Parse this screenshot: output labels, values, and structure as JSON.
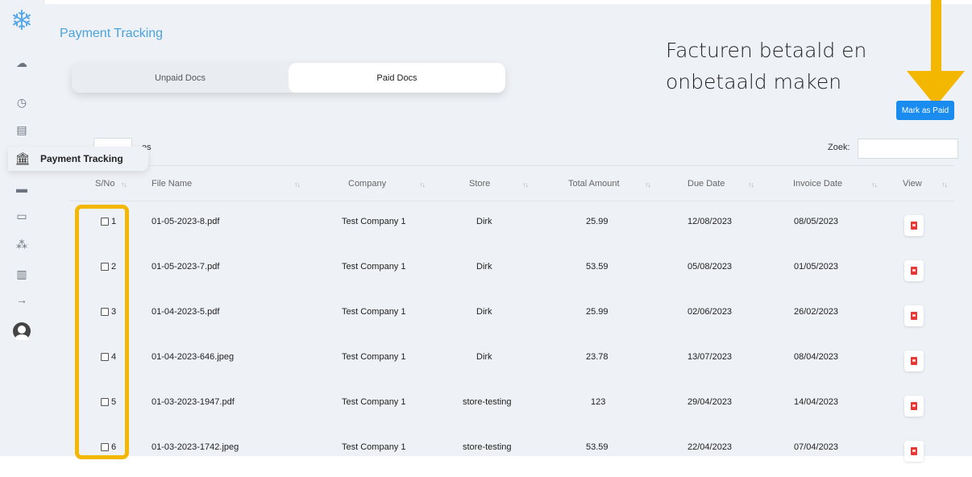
{
  "sidebar": {
    "logo_icon": "snowflake-icon",
    "icons": [
      "cloud-upload-icon",
      "clock-icon",
      "document-icon",
      "bank-icon",
      "book-icon",
      "store-icon",
      "users-icon",
      "building-icon",
      "arrow-right-icon",
      "avatar-icon"
    ],
    "active_item": {
      "label": "Payment Tracking",
      "icon": "bank-icon"
    }
  },
  "header": {
    "title": "Payment Tracking"
  },
  "tabs": [
    {
      "label": "Unpaid Docs",
      "active": false
    },
    {
      "label": "Paid Docs",
      "active": true
    }
  ],
  "annotation": {
    "line1": "Facturen betaald en",
    "line2": "onbetaald maken",
    "color": "#f4b700"
  },
  "toolbar": {
    "mark_paid_label": "Mark as Paid",
    "show_suffix": "es",
    "search_label": "Zoek:",
    "search_value": ""
  },
  "table": {
    "columns": [
      "S/No",
      "File Name",
      "Company",
      "Store",
      "Total Amount",
      "Due Date",
      "Invoice Date",
      "View"
    ],
    "rows": [
      {
        "sno": "1",
        "file": "01-05-2023-8.pdf",
        "company": "Test Company 1",
        "store": "Dirk",
        "amount": "25.99",
        "due": "12/08/2023",
        "invoice": "08/05/2023"
      },
      {
        "sno": "2",
        "file": "01-05-2023-7.pdf",
        "company": "Test Company 1",
        "store": "Dirk",
        "amount": "53.59",
        "due": "05/08/2023",
        "invoice": "01/05/2023"
      },
      {
        "sno": "3",
        "file": "01-04-2023-5.pdf",
        "company": "Test Company 1",
        "store": "Dirk",
        "amount": "25.99",
        "due": "02/06/2023",
        "invoice": "26/02/2023"
      },
      {
        "sno": "4",
        "file": "01-04-2023-646.jpeg",
        "company": "Test Company 1",
        "store": "Dirk",
        "amount": "23.78",
        "due": "13/07/2023",
        "invoice": "08/04/2023"
      },
      {
        "sno": "5",
        "file": "01-03-2023-1947.pdf",
        "company": "Test Company 1",
        "store": "store-testing",
        "amount": "123",
        "due": "29/04/2023",
        "invoice": "14/04/2023"
      },
      {
        "sno": "6",
        "file": "01-03-2023-1742.jpeg",
        "company": "Test Company 1",
        "store": "store-testing",
        "amount": "53.59",
        "due": "22/04/2023",
        "invoice": "07/04/2023"
      }
    ]
  },
  "colors": {
    "accent": "#4aa3df",
    "button": "#1a8cf0",
    "pdf": "#e53935",
    "highlight": "#f4b700"
  }
}
